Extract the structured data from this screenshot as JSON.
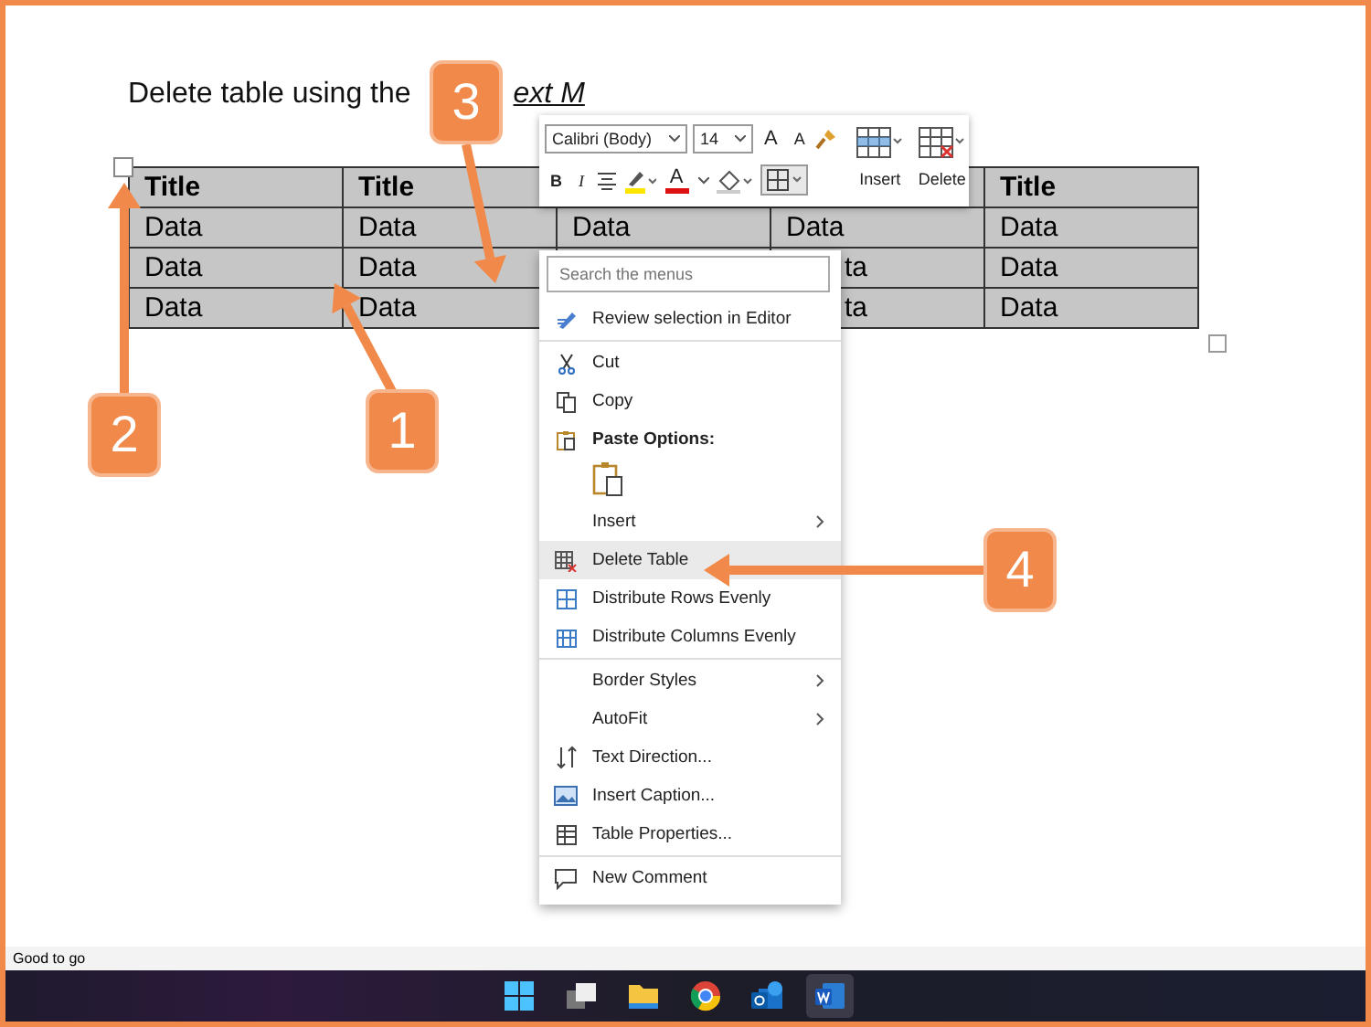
{
  "document": {
    "heading": "Delete table using the",
    "heading_cut": "ext M"
  },
  "table": {
    "rows": [
      {
        "cells": [
          "Title",
          "Title",
          "",
          "",
          "Title"
        ]
      },
      {
        "cells": [
          "Data",
          "Data",
          "Data",
          "Data",
          "Data"
        ]
      },
      {
        "cells": [
          "Data",
          "Data",
          "",
          {
            "text": "ta",
            "kind": "clipped"
          },
          "Data"
        ]
      },
      {
        "cells": [
          "Data",
          "Data",
          "",
          {
            "text": "ta",
            "kind": "clipped"
          },
          "Data"
        ]
      }
    ]
  },
  "toolbar": {
    "font": "Calibri (Body)",
    "size": "14",
    "grow_font": "A",
    "shrink_font": "A",
    "bold": "B",
    "italic": "I",
    "font_color": "A",
    "insert": "Insert",
    "delete": "Delete"
  },
  "context_menu": {
    "search_placeholder": "Search the menus",
    "groups": [
      [
        {
          "kind": "item",
          "label": "Review selection in Editor",
          "submenu": false,
          "selected": false
        }
      ],
      [
        {
          "kind": "item",
          "label": "Cut",
          "submenu": false,
          "selected": false
        },
        {
          "kind": "item",
          "label": "Copy",
          "submenu": false,
          "selected": false
        },
        {
          "kind": "section",
          "label": "Paste Options:",
          "submenu": false,
          "selected": false
        },
        {
          "kind": "paste",
          "submenu": false,
          "selected": false
        },
        {
          "kind": "item",
          "label": "Insert",
          "submenu": true,
          "selected": false
        },
        {
          "kind": "item",
          "label": "Delete Table",
          "submenu": false,
          "selected": true
        },
        {
          "kind": "item",
          "label": "Distribute Rows Evenly",
          "submenu": false,
          "selected": false
        },
        {
          "kind": "item",
          "label": "Distribute Columns Evenly",
          "submenu": false,
          "selected": false
        }
      ],
      [
        {
          "kind": "item",
          "label": "Border Styles",
          "submenu": true,
          "selected": false
        },
        {
          "kind": "item",
          "label": "AutoFit",
          "submenu": true,
          "selected": false
        },
        {
          "kind": "item",
          "label": "Text Direction...",
          "submenu": false,
          "selected": false
        },
        {
          "kind": "item",
          "label": "Insert Caption...",
          "submenu": false,
          "selected": false
        },
        {
          "kind": "item",
          "label": "Table Properties...",
          "submenu": false,
          "selected": false
        }
      ],
      [
        {
          "kind": "item",
          "label": "New Comment",
          "submenu": false,
          "selected": false
        }
      ]
    ]
  },
  "callouts": [
    {
      "number": "1"
    },
    {
      "number": "2"
    },
    {
      "number": "3"
    },
    {
      "number": "4"
    }
  ],
  "status_bar": {
    "text": "Good to go"
  },
  "taskbar": {
    "apps": [
      {
        "selected": false
      },
      {
        "selected": false
      },
      {
        "selected": false
      },
      {
        "selected": false
      },
      {
        "selected": false
      },
      {
        "selected": true
      }
    ]
  }
}
